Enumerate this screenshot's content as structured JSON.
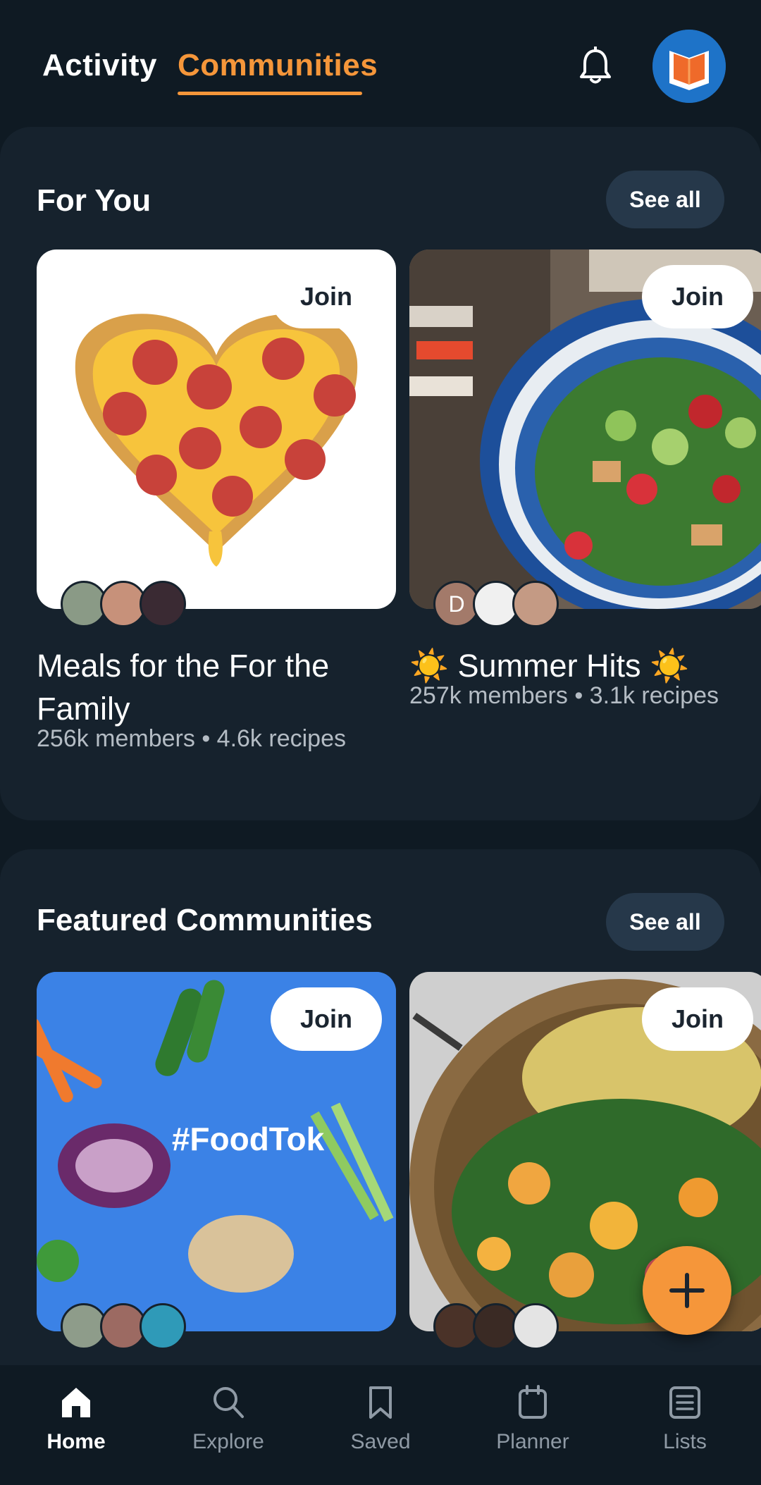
{
  "header": {
    "tabs": [
      {
        "label": "Activity",
        "active": false
      },
      {
        "label": "Communities",
        "active": true
      }
    ],
    "accent_color": "#f5963a",
    "icons": [
      "bell-icon",
      "avatar"
    ]
  },
  "for_you": {
    "title": "For You",
    "see_all": "See all",
    "cards": [
      {
        "name": "Meals for the For the Family",
        "meta": "256k members • 4.6k recipes",
        "join": "Join",
        "image": "heart-pizza"
      },
      {
        "name": "☀️ Summer Hits ☀️",
        "meta": "257k members • 3.1k recipes",
        "join": "Join",
        "image": "salad-bowl",
        "avatar_initial": "D"
      }
    ]
  },
  "featured": {
    "title": "Featured Communities",
    "see_all": "See all",
    "cards": [
      {
        "join": "Join",
        "image": "foodtok",
        "image_text": "#FoodTok"
      },
      {
        "join": "Join",
        "image": "quinoa-salad"
      }
    ]
  },
  "fab": {
    "icon": "plus-icon"
  },
  "bottom_nav": [
    {
      "label": "Home",
      "icon": "home-icon",
      "active": true
    },
    {
      "label": "Explore",
      "icon": "search-icon",
      "active": false
    },
    {
      "label": "Saved",
      "icon": "bookmark-icon",
      "active": false
    },
    {
      "label": "Planner",
      "icon": "calendar-icon",
      "active": false
    },
    {
      "label": "Lists",
      "icon": "list-icon",
      "active": false
    }
  ]
}
